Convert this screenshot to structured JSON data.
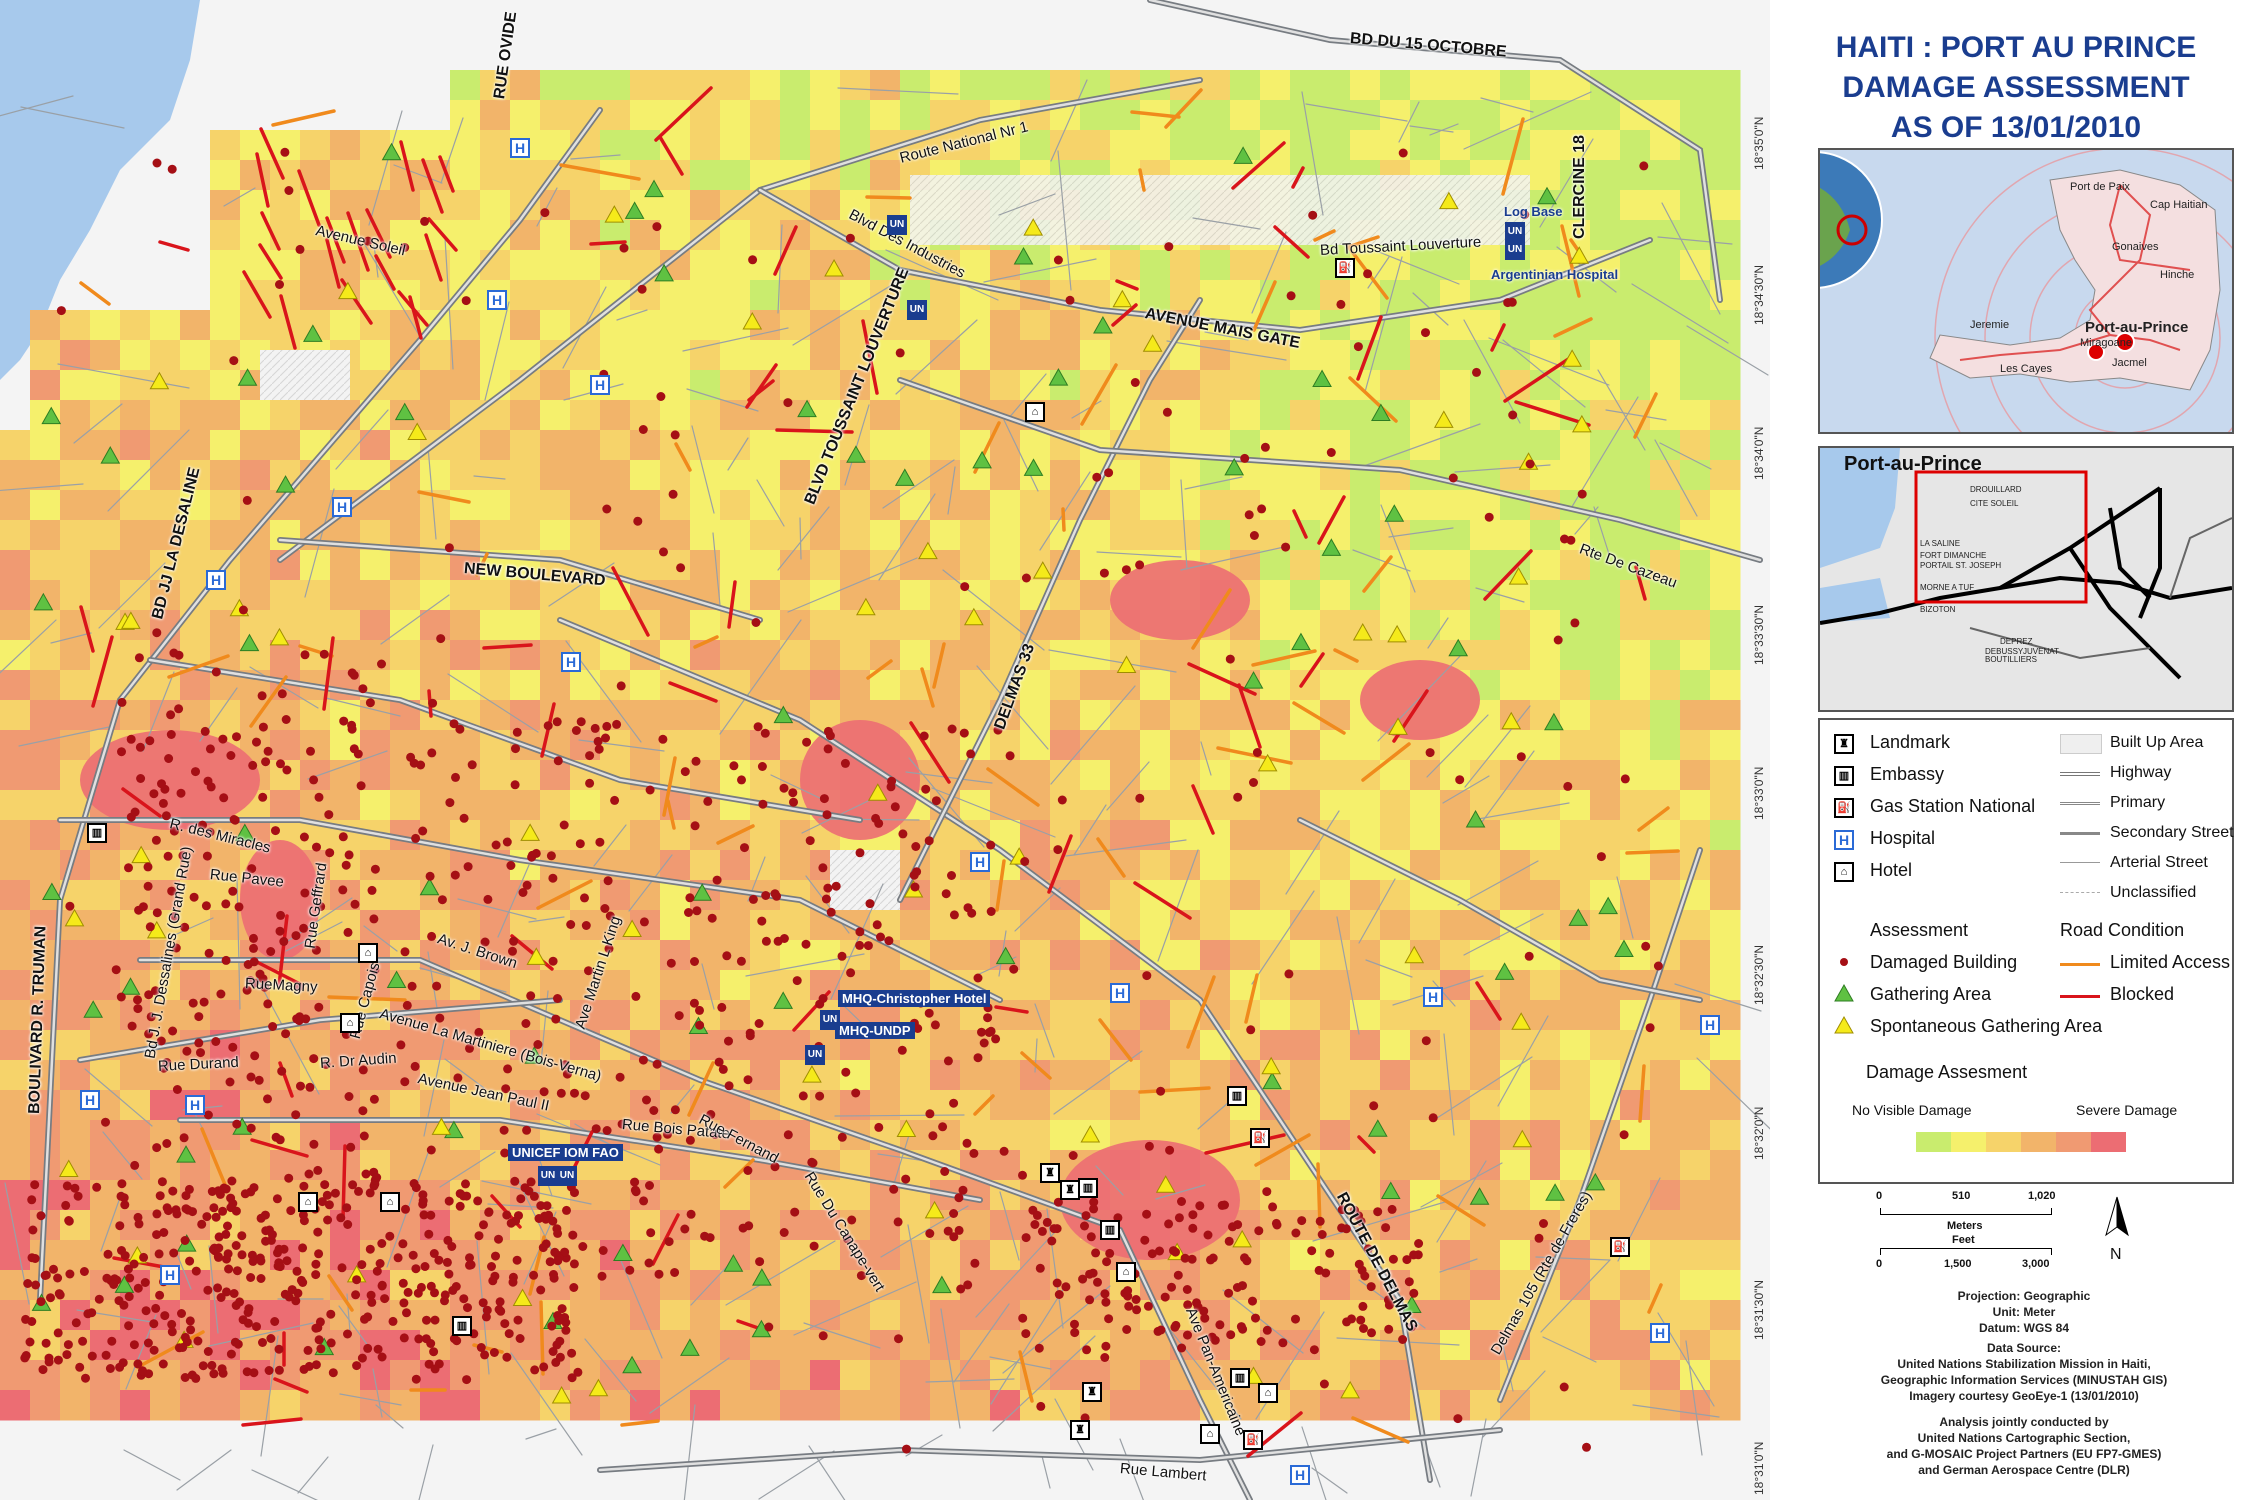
{
  "title": {
    "line1": "HAITI : PORT AU PRINCE",
    "line2": "DAMAGE ASSESSMENT",
    "line3": "AS OF 13/01/2010"
  },
  "overview_map": {
    "cities": [
      "Port de Paix",
      "Cap Haitian",
      "Gonaives",
      "Hinche",
      "Jeremie",
      "Port-au-Prince",
      "Miragoane",
      "Les Cayes",
      "Jacmel"
    ],
    "highlight": "Port-au-Prince"
  },
  "inset_map": {
    "title": "Port-au-Prince",
    "places": [
      "DROUILLARD",
      "CITE SOLEIL",
      "LA SALINE",
      "FORT DIMANCHE",
      "PORTAIL ST. JOSEPH",
      "MORNE A TUF",
      "BIZOTON",
      "DEPREZ",
      "DEBUSSY",
      "JUVENAT",
      "BOUTILLIERS"
    ]
  },
  "legend": {
    "point_symbols": [
      "Landmark",
      "Embassy",
      "Gas Station National",
      "Hospital",
      "Hotel"
    ],
    "area_and_roads": [
      "Built Up Area",
      "Highway",
      "Primary",
      "Secondary Street",
      "Arterial Street",
      "Unclassified"
    ],
    "assessment_title": "Assessment",
    "assessment_items": [
      "Damaged Building",
      "Gathering Area",
      "Spontaneous Gathering Area"
    ],
    "road_condition_title": "Road Condition",
    "road_condition_items": [
      "Limited Access",
      "Blocked"
    ],
    "damage_title": "Damage Assesment",
    "damage_low": "No Visible Damage",
    "damage_high": "Severe Damage",
    "damage_colors": [
      "#c9ec6e",
      "#f5f06c",
      "#f6d36a",
      "#f2b46a",
      "#f09a72",
      "#ec6d73"
    ]
  },
  "scale_bar": {
    "meters_ticks": [
      "0",
      "510",
      "1,020"
    ],
    "meters_label": "Meters",
    "feet_label": "Feet",
    "feet_ticks": [
      "0",
      "1,500",
      "3,000"
    ],
    "north": "N"
  },
  "credits": {
    "projection": "Projection: Geographic",
    "unit": "Unit: Meter",
    "datum": "Datum: WGS 84",
    "source_title": "Data Source:",
    "source_1": "United Nations Stabilization Mission in Haiti,",
    "source_2": "Geographic Information Services (MINUSTAH GIS)",
    "source_3": "Imagery courtesy GeoEye-1 (13/01/2010)",
    "analysis_1": "Analysis jointly conducted by",
    "analysis_2": "United Nations Cartographic Section,",
    "analysis_3": "and G-MOSAIC Project Partners (EU FP7-GMES)",
    "analysis_4": "and German Aerospace Centre (DLR)"
  },
  "street_labels": {
    "bd15oct": "BD DU 15 OCTOBRE",
    "ovide": "RUE OVIDE",
    "route_nat": "Route National Nr 1",
    "bvd_industries": "Blvd Des Industries",
    "log_base": "Log Base",
    "clercine": "CLERCINE 18",
    "avenue_soleil": "Avenue Soleil",
    "bd_toussaint": "Bd Toussaint Louverture",
    "argentinian": "Argentinian Hospital",
    "avenue_mais_gate": "AVENUE MAIS GATE",
    "bvd_toussaint": "BLVD TOUSSAINT LOUVERTURE",
    "jj_desaline": "BD JJ LA DESALINE",
    "new_boulevard": "NEW BOULEVARD",
    "rte_cazeau": "Rte De Cazeau",
    "delmas33": "DELMAS 33",
    "miracles": "R. des Miracles",
    "pavee": "Rue Pavee",
    "geffrard": "Rue Geffrard",
    "av_brown": "Av. J. Brown",
    "mlk": "Ave Martin L King",
    "ruemagny": "RueMagny",
    "grand_rue": "Bd J. J. Dessalines (Grand Rue)",
    "truman": "BOULIVARD R. TRUMAN",
    "martiniere": "Avenue La Martiniere (Bois-Verna)",
    "capois": "Rue Capois",
    "durand": "Rue Durand",
    "dr_audin": "R. Dr Audin",
    "jean_paul": "Avenue Jean Paul II",
    "bois_patate": "Rue Bois Patate",
    "fernand": "Rue Fernand",
    "canapevert": "Rue Du Canape-vert",
    "panamericaine": "Ave Pan-Americaine",
    "route_delmas": "ROUTE DE DELMAS",
    "delmas105": "Delmas 105 (Rte de Freres)",
    "lambert": "Rue Lambert",
    "mhq_hotel": "MHQ-Christopher Hotel",
    "mhq_undp": "MHQ-UNDP",
    "unicef": "UNICEF IOM FAO"
  },
  "icon_glyphs": {
    "un": "UN",
    "hospital": "H",
    "hotel": "⌂",
    "embassy": "▥",
    "landmark": "♜",
    "gas": "⛽"
  },
  "lat_ticks": [
    "18°35'0\"N",
    "18°34'30\"N",
    "18°34'0\"N",
    "18°33'30\"N",
    "18°33'0\"N",
    "18°32'30\"N",
    "18°32'0\"N",
    "18°31'30\"N",
    "18°31'0\"N"
  ]
}
